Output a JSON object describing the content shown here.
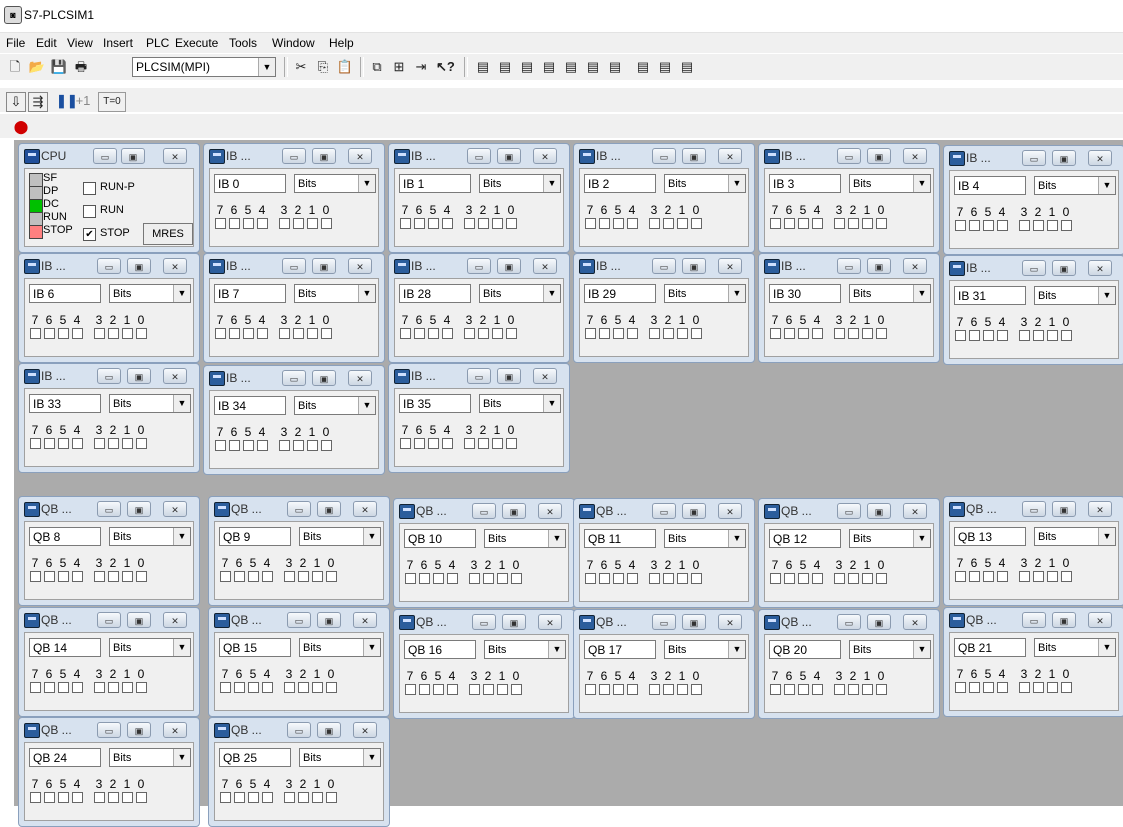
{
  "window_title": "S7-PLCSIM1",
  "menu": [
    "File",
    "Edit",
    "View",
    "Insert",
    "PLC",
    "Execute",
    "Tools",
    "Window",
    "Help"
  ],
  "toolbar": {
    "pg_pc_interface": "PLCSIM(MPI)",
    "step_label": "+1",
    "timer_label": "T=0"
  },
  "cpu": {
    "title": "CPU",
    "leds": [
      "SF",
      "DP",
      "DC",
      "RUN",
      "STOP"
    ],
    "led_colors": [
      "#c0c0c0",
      "#c0c0c0",
      "#00c000",
      "#c0c0c0",
      "#ff8080"
    ],
    "mode_run_p": "RUN-P",
    "mode_run": "RUN",
    "mode_stop": "STOP",
    "mres_label": "MRES"
  },
  "bit_labels": [
    "7",
    "6",
    "5",
    "4",
    "3",
    "2",
    "1",
    "0"
  ],
  "input_windows": [
    {
      "title": "IB ...",
      "address": "IB   0",
      "format": "Bits"
    },
    {
      "title": "IB ...",
      "address": "IB   1",
      "format": "Bits"
    },
    {
      "title": "IB ...",
      "address": "IB   2",
      "format": "Bits"
    },
    {
      "title": "IB ...",
      "address": "IB   3",
      "format": "Bits"
    },
    {
      "title": "IB ...",
      "address": "IB   4",
      "format": "Bits"
    },
    {
      "title": "IB ...",
      "address": "IB   6",
      "format": "Bits"
    },
    {
      "title": "IB ...",
      "address": "IB   7",
      "format": "Bits"
    },
    {
      "title": "IB ...",
      "address": "IB   28",
      "format": "Bits"
    },
    {
      "title": "IB ...",
      "address": "IB   29",
      "format": "Bits"
    },
    {
      "title": "IB ...",
      "address": "IB   30",
      "format": "Bits"
    },
    {
      "title": "IB ...",
      "address": "IB   31",
      "format": "Bits"
    },
    {
      "title": "IB ...",
      "address": "IB   33",
      "format": "Bits"
    },
    {
      "title": "IB ...",
      "address": "IB   34",
      "format": "Bits"
    },
    {
      "title": "IB ...",
      "address": "IB   35",
      "format": "Bits"
    }
  ],
  "output_windows": [
    {
      "title": "QB ...",
      "address": "QB   8",
      "format": "Bits"
    },
    {
      "title": "QB ...",
      "address": "QB   9",
      "format": "Bits"
    },
    {
      "title": "QB ...",
      "address": "QB   10",
      "format": "Bits"
    },
    {
      "title": "QB ...",
      "address": "QB   11",
      "format": "Bits"
    },
    {
      "title": "QB ...",
      "address": "QB   12",
      "format": "Bits"
    },
    {
      "title": "QB ...",
      "address": "QB   13",
      "format": "Bits"
    },
    {
      "title": "QB ...",
      "address": "QB   14",
      "format": "Bits"
    },
    {
      "title": "QB ...",
      "address": "QB   15",
      "format": "Bits"
    },
    {
      "title": "QB ...",
      "address": "QB   16",
      "format": "Bits"
    },
    {
      "title": "QB ...",
      "address": "QB   17",
      "format": "Bits"
    },
    {
      "title": "QB ...",
      "address": "QB   20",
      "format": "Bits"
    },
    {
      "title": "QB ...",
      "address": "QB   21",
      "format": "Bits"
    },
    {
      "title": "QB ...",
      "address": "QB   24",
      "format": "Bits"
    },
    {
      "title": "QB ...",
      "address": "QB   25",
      "format": "Bits"
    }
  ]
}
